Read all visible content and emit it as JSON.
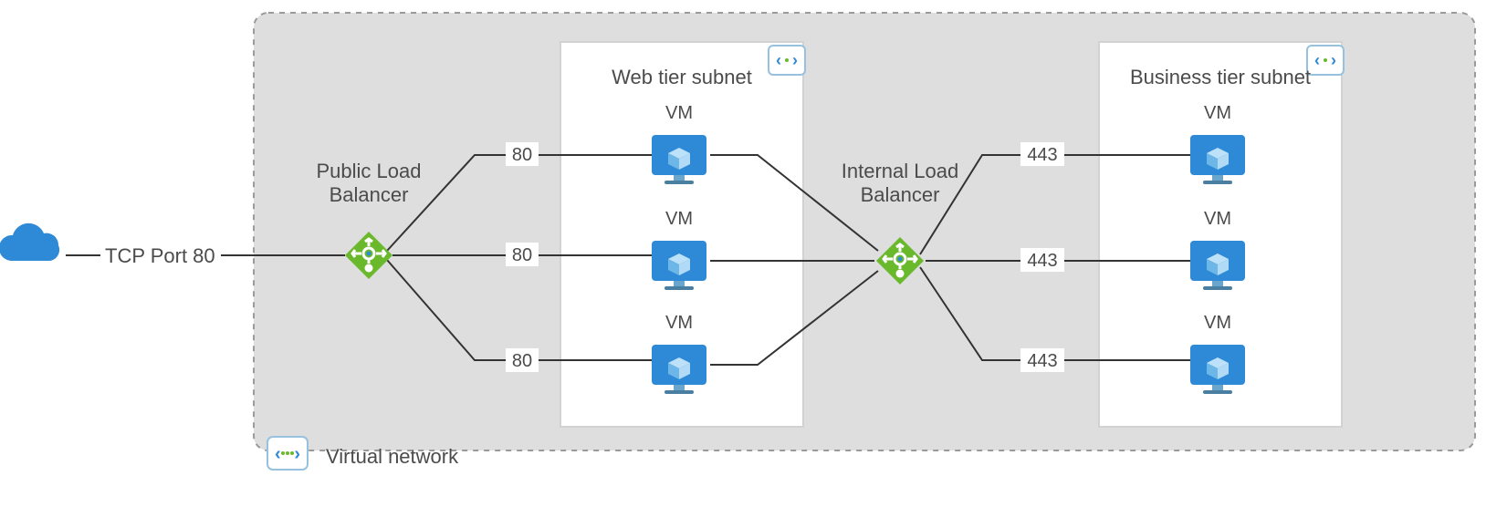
{
  "internet_label": "TCP Port 80",
  "vnet_label": "Virtual network",
  "public_lb": {
    "label1": "Public Load",
    "label2": "Balancer",
    "ports": [
      "80",
      "80",
      "80"
    ]
  },
  "internal_lb": {
    "label1": "Internal Load",
    "label2": "Balancer",
    "ports": [
      "443",
      "443",
      "443"
    ]
  },
  "web_subnet": {
    "title": "Web tier subnet",
    "vm_labels": [
      "VM",
      "VM",
      "VM"
    ]
  },
  "biz_subnet": {
    "title": "Business tier subnet",
    "vm_labels": [
      "VM",
      "VM",
      "VM"
    ]
  }
}
